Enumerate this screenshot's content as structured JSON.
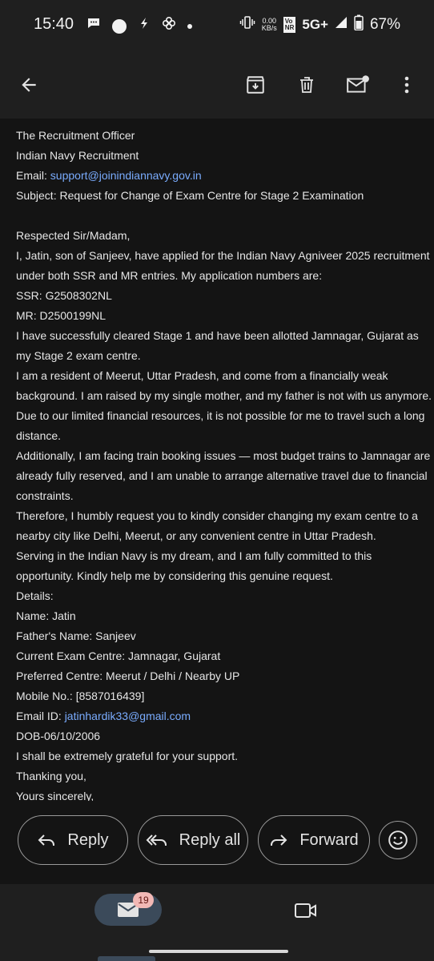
{
  "status_bar": {
    "time": "15:40",
    "net_speed_value": "0.00",
    "net_speed_unit": "KB/s",
    "vonr_top": "Vo",
    "vonr_bottom": "NR",
    "network": "5G+",
    "battery": "67%"
  },
  "email": {
    "lines": [
      "The Recruitment Officer",
      "Indian Navy Recruitment"
    ],
    "email_label": "Email: ",
    "email_link": "support@joinindiannavy.gov.in",
    "subject": "Subject: Request for Change of Exam Centre for Stage 2 Examination",
    "body": [
      "Respected Sir/Madam,",
      "I, Jatin, son of Sanjeev, have applied for the Indian Navy Agniveer 2025 recruitment",
      "under both SSR and MR entries. My application numbers are:",
      "SSR: G2508302NL",
      "MR: D2500199NL",
      "I have successfully cleared Stage 1 and have been allotted Jamnagar, Gujarat as",
      "my Stage 2 exam centre.",
      "I am a resident of Meerut, Uttar Pradesh, and come from a financially weak",
      "background. I am raised by my single mother, and my father is not with us anymore.",
      "Due to our limited financial resources, it is not possible for me to travel such a long",
      "distance.",
      "Additionally, I am facing train booking issues — most budget trains to Jamnagar are",
      "already fully reserved, and I am unable to arrange alternative travel due to financial",
      "constraints.",
      "Therefore, I humbly request you to kindly consider changing my exam centre to a",
      "nearby city like Delhi, Meerut, or any convenient centre in Uttar Pradesh.",
      "Serving in the Indian Navy is my dream, and I am fully committed to this",
      "opportunity. Kindly help me by considering this genuine request.",
      "Details:",
      "Name: Jatin",
      "Father's Name: Sanjeev",
      "Current Exam Centre: Jamnagar, Gujarat",
      "Preferred Centre: Meerut / Delhi / Nearby UP",
      "Mobile No.: [8587016439]"
    ],
    "email_id_label": "Email ID: ",
    "email_id_link": "jatinhardik33@gmail.com",
    "closing": [
      "DOB-06/10/2006",
      "I shall be extremely grateful for your support.",
      "Thanking you,",
      "Yours sincerely,"
    ]
  },
  "actions": {
    "reply": "Reply",
    "reply_all": "Reply all",
    "forward": "Forward"
  },
  "bottom_nav": {
    "mail_badge": "19"
  },
  "colors": {
    "link": "#7aacfe",
    "background": "#141414",
    "bar": "#1f1f1f",
    "badge": "#f2b8b5"
  }
}
